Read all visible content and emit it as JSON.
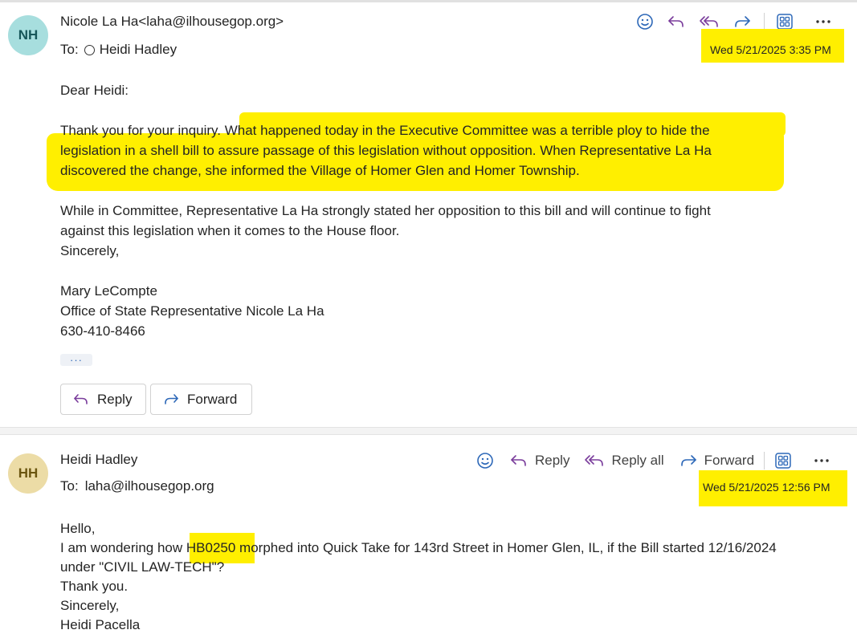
{
  "colors": {
    "highlight": "#ffef00",
    "avatar_nh_bg": "#a7dede",
    "avatar_hh_bg": "#ecdca6",
    "icon_blue": "#2d68b8",
    "icon_purple": "#7a3d9c"
  },
  "message1": {
    "avatar_initials": "NH",
    "sender": "Nicole La Ha<laha@ilhousegop.org>",
    "to_label": "To:",
    "to_value": "Heidi Hadley",
    "date": "Wed 5/21/2025 3:35 PM",
    "toolbar_icons": [
      "emoji-icon",
      "reply-icon",
      "reply-all-icon",
      "forward-icon",
      "apps-icon",
      "more-icon"
    ],
    "body": {
      "greeting": "Dear Heidi:",
      "para1_lines": [
        "Thank you for your inquiry.  What happened today in the Executive Committee was a terrible ploy to hide the",
        "legislation in a shell bill to assure passage of this legislation without opposition.  When Representative La Ha",
        "discovered the change, she informed the Village of Homer Glen and Homer Township."
      ],
      "para2_lines": [
        "While in Committee, Representative La Ha strongly stated her opposition to this bill and will continue to fight",
        "against this legislation when it comes to the House floor.",
        "Sincerely,"
      ],
      "signature_lines": [
        "Mary LeCompte",
        "Office of State Representative Nicole La Ha",
        "630-410-8466"
      ]
    },
    "ellipsis_label": "···",
    "reply_button": "Reply",
    "forward_button": "Forward"
  },
  "message2": {
    "avatar_initials": "HH",
    "sender": "Heidi Hadley",
    "to_label": "To:",
    "to_value": "laha@ilhousegop.org",
    "date": "Wed 5/21/2025 12:56 PM",
    "toolbar": {
      "reply_label": "Reply",
      "reply_all_label": "Reply all",
      "forward_label": "Forward"
    },
    "body": {
      "line1": "Hello,",
      "line2_pre": "I am wondering how ",
      "line2_code": "HB0250",
      "line2_post": " morphed into Quick Take for 143rd Street in Homer Glen, IL, if the Bill started 12/16/2024",
      "line3": "under \"CIVIL LAW-TECH\"?",
      "line4": "Thank you.",
      "line5": "Sincerely,",
      "line6": "Heidi Pacella"
    }
  }
}
